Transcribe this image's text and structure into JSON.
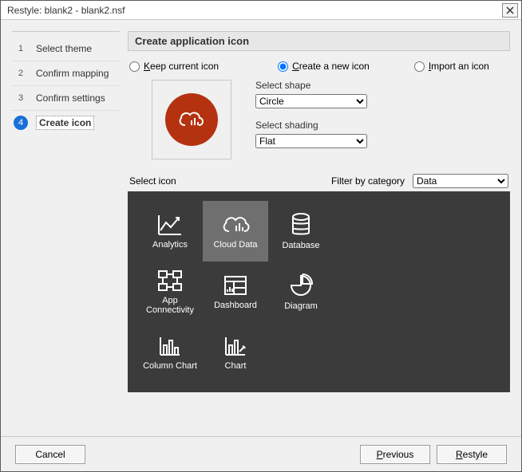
{
  "window": {
    "title": "Restyle: blank2 - blank2.nsf"
  },
  "steps": [
    {
      "num": "1",
      "label": "Select theme"
    },
    {
      "num": "2",
      "label": "Confirm mapping"
    },
    {
      "num": "3",
      "label": "Confirm settings"
    },
    {
      "num": "4",
      "label": "Create icon"
    }
  ],
  "active_step_index": 3,
  "heading": "Create application icon",
  "radios": {
    "keep": "Keep current icon",
    "create": "Create a new icon",
    "import": "Import an icon",
    "selected": "create"
  },
  "shape": {
    "label": "Select shape",
    "value": "Circle",
    "options": [
      "Circle"
    ]
  },
  "shading": {
    "label": "Select shading",
    "value": "Flat",
    "options": [
      "Flat"
    ]
  },
  "preview_color": "#b53210",
  "select_icon_label": "Select icon",
  "filter_label": "Filter by category",
  "filter_value": "Data",
  "filter_options": [
    "Data"
  ],
  "icons": [
    {
      "id": "analytics",
      "label": "Analytics"
    },
    {
      "id": "cloud-data",
      "label": "Cloud Data",
      "selected": true
    },
    {
      "id": "database",
      "label": "Database"
    },
    {
      "id": "app-connectivity",
      "label": "App\nConnectivity"
    },
    {
      "id": "dashboard",
      "label": "Dashboard"
    },
    {
      "id": "diagram",
      "label": "Diagram"
    },
    {
      "id": "column-chart",
      "label": "Column Chart"
    },
    {
      "id": "chart",
      "label": "Chart"
    }
  ],
  "buttons": {
    "cancel": "Cancel",
    "previous": "Previous",
    "restyle": "Restyle"
  }
}
